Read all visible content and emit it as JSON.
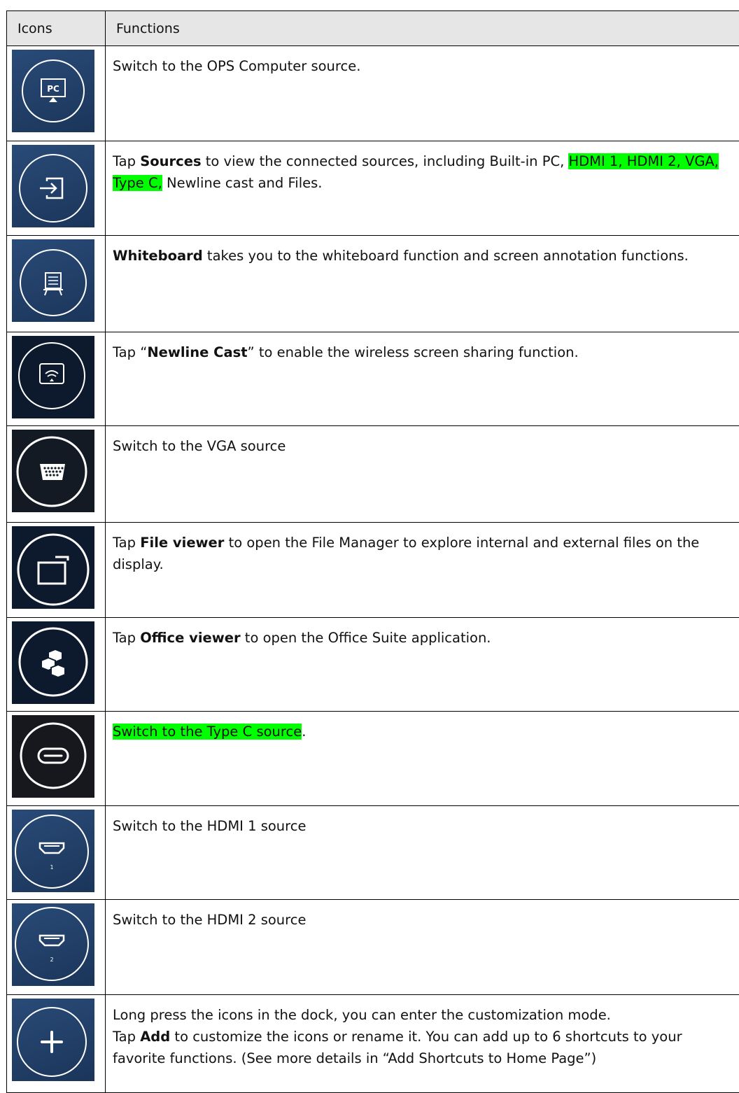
{
  "table": {
    "headers": {
      "icons": "Icons",
      "functions": "Functions"
    },
    "rows": [
      {
        "icon": "pc-icon",
        "segments": [
          {
            "text": "Switch to the OPS Computer source."
          }
        ]
      },
      {
        "icon": "sources-input-icon",
        "segments": [
          {
            "text": "Tap "
          },
          {
            "text": "Sources",
            "bold": true
          },
          {
            "text": " to view the connected sources, including Built-in PC, "
          },
          {
            "text": "HDMI 1, HDMI 2, VGA, Type C,",
            "highlight": true
          },
          {
            "text": " Newline cast and Files."
          }
        ]
      },
      {
        "icon": "whiteboard-icon",
        "segments": [
          {
            "text": "Whiteboard",
            "bold": true
          },
          {
            "text": " takes you to the whiteboard function and screen annotation functions."
          }
        ]
      },
      {
        "icon": "cast-icon",
        "segments": [
          {
            "text": "Tap “"
          },
          {
            "text": "Newline Cast",
            "bold": true
          },
          {
            "text": "” to enable the wireless screen sharing function."
          }
        ]
      },
      {
        "icon": "vga-port-icon",
        "segments": [
          {
            "text": "Switch to the VGA source"
          }
        ]
      },
      {
        "icon": "file-viewer-icon",
        "segments": [
          {
            "text": "Tap "
          },
          {
            "text": "File viewer",
            "bold": true
          },
          {
            "text": " to open the File Manager to explore internal and external files on the display."
          }
        ]
      },
      {
        "icon": "office-viewer-icon",
        "segments": [
          {
            "text": "Tap "
          },
          {
            "text": "Office viewer",
            "bold": true
          },
          {
            "text": " to open the Office Suite application."
          }
        ]
      },
      {
        "icon": "type-c-icon",
        "segments": [
          {
            "text": "Switch to the Type C source",
            "highlight": true
          },
          {
            "text": "."
          }
        ]
      },
      {
        "icon": "hdmi-1-icon",
        "badge": "1",
        "segments": [
          {
            "text": "Switch to the HDMI 1 source"
          }
        ]
      },
      {
        "icon": "hdmi-2-icon",
        "badge": "2",
        "segments": [
          {
            "text": "Switch to the HDMI 2 source"
          }
        ]
      },
      {
        "icon": "add-shortcut-icon",
        "segments": [
          {
            "text": "Long press the icons in the dock, you can enter the customization mode.",
            "br": true
          },
          {
            "text": "Tap "
          },
          {
            "text": "Add",
            "bold": true
          },
          {
            "text": " to customize the icons or rename it. You can add up to 6 shortcuts to your favorite functions. (See more details in “Add Shortcuts to Home Page”)"
          }
        ]
      }
    ]
  }
}
